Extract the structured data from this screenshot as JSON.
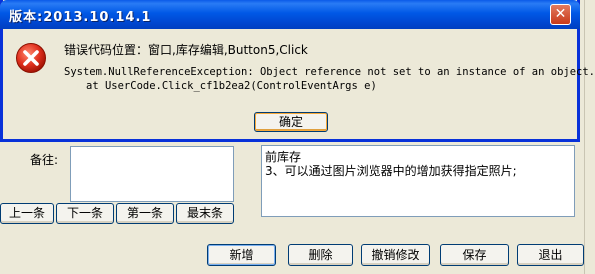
{
  "dialog": {
    "title": "版本:2013.10.14.1",
    "close_glyph": "✕",
    "icon": "error-icon",
    "location_text": "错误代码位置：窗口,库存编辑,Button5,Click",
    "exception_text": "System.NullReferenceException: Object reference not set to an instance of an object.",
    "stack_text": "at UserCode.Click_cf1b2ea2(ControlEventArgs e)",
    "ok_label": "确定"
  },
  "form": {
    "notes_label": "备往:",
    "notes_value": "",
    "hint_lines": [
      "前库存",
      "3、可以通过图片浏览器中的增加获得指定照片;"
    ]
  },
  "nav_buttons": [
    "上一条",
    "下一条",
    "第一条",
    "最末条"
  ],
  "action_buttons": [
    "新增",
    "删除",
    "撤销修改",
    "保存",
    "退出"
  ],
  "colors": {
    "titlebar": "#0058e6",
    "dialog_border": "#0831d9",
    "window_bg": "#ece9d8",
    "error_red": "#e0301e"
  }
}
